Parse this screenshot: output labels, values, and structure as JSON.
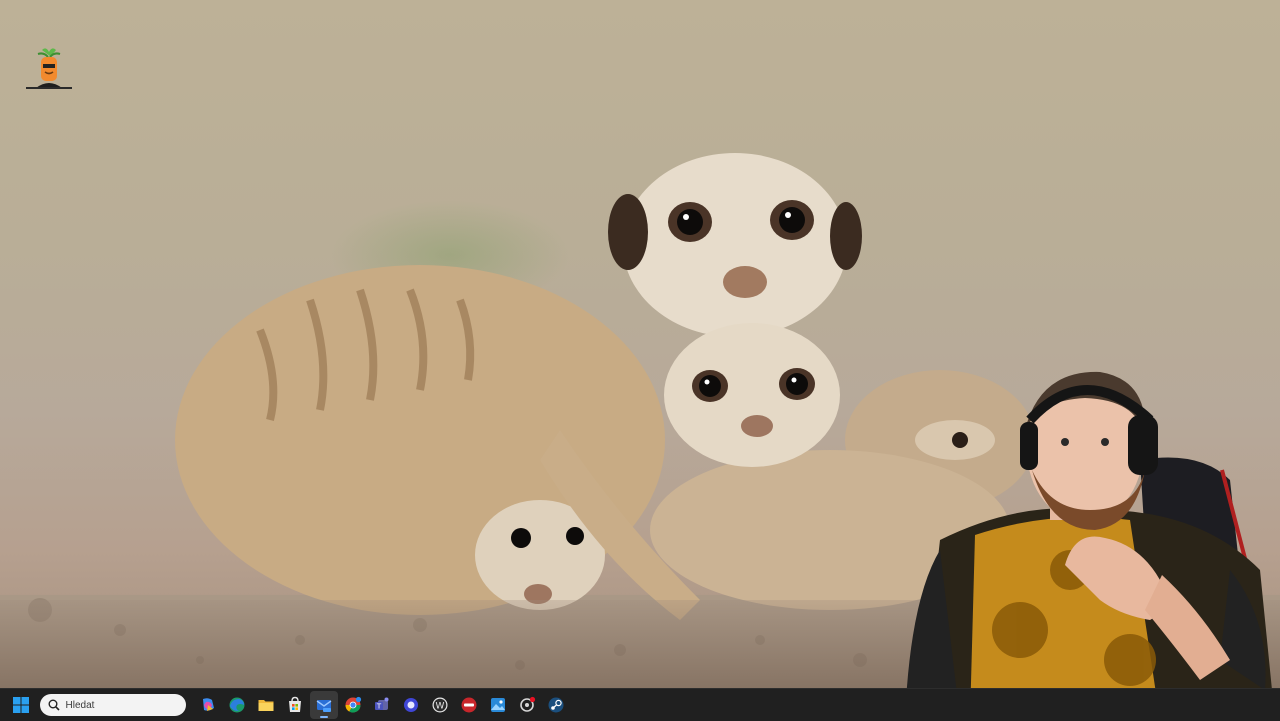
{
  "taskbar": {
    "search": {
      "placeholder": "Hledat"
    },
    "apps": [
      {
        "name": "copilot-icon"
      },
      {
        "name": "edge-icon"
      },
      {
        "name": "file-explorer-icon"
      },
      {
        "name": "microsoft-store-icon"
      },
      {
        "name": "mail-icon",
        "active": true
      },
      {
        "name": "chrome-icon"
      },
      {
        "name": "teams-icon"
      },
      {
        "name": "assistant-icon"
      },
      {
        "name": "wordpad-icon"
      },
      {
        "name": "recorder-icon"
      },
      {
        "name": "photos-icon"
      },
      {
        "name": "settings-icon"
      },
      {
        "name": "steam-icon"
      }
    ]
  },
  "desktop": {
    "icons": [
      {
        "name": "carrot-character-icon"
      }
    ],
    "wallpaper": "meerkat-family-photo",
    "overlay": "webcam-streamer"
  },
  "colors": {
    "taskbar_bg": "#202020",
    "search_bg": "#f3f3f3",
    "accent": "#7fb7ff"
  }
}
